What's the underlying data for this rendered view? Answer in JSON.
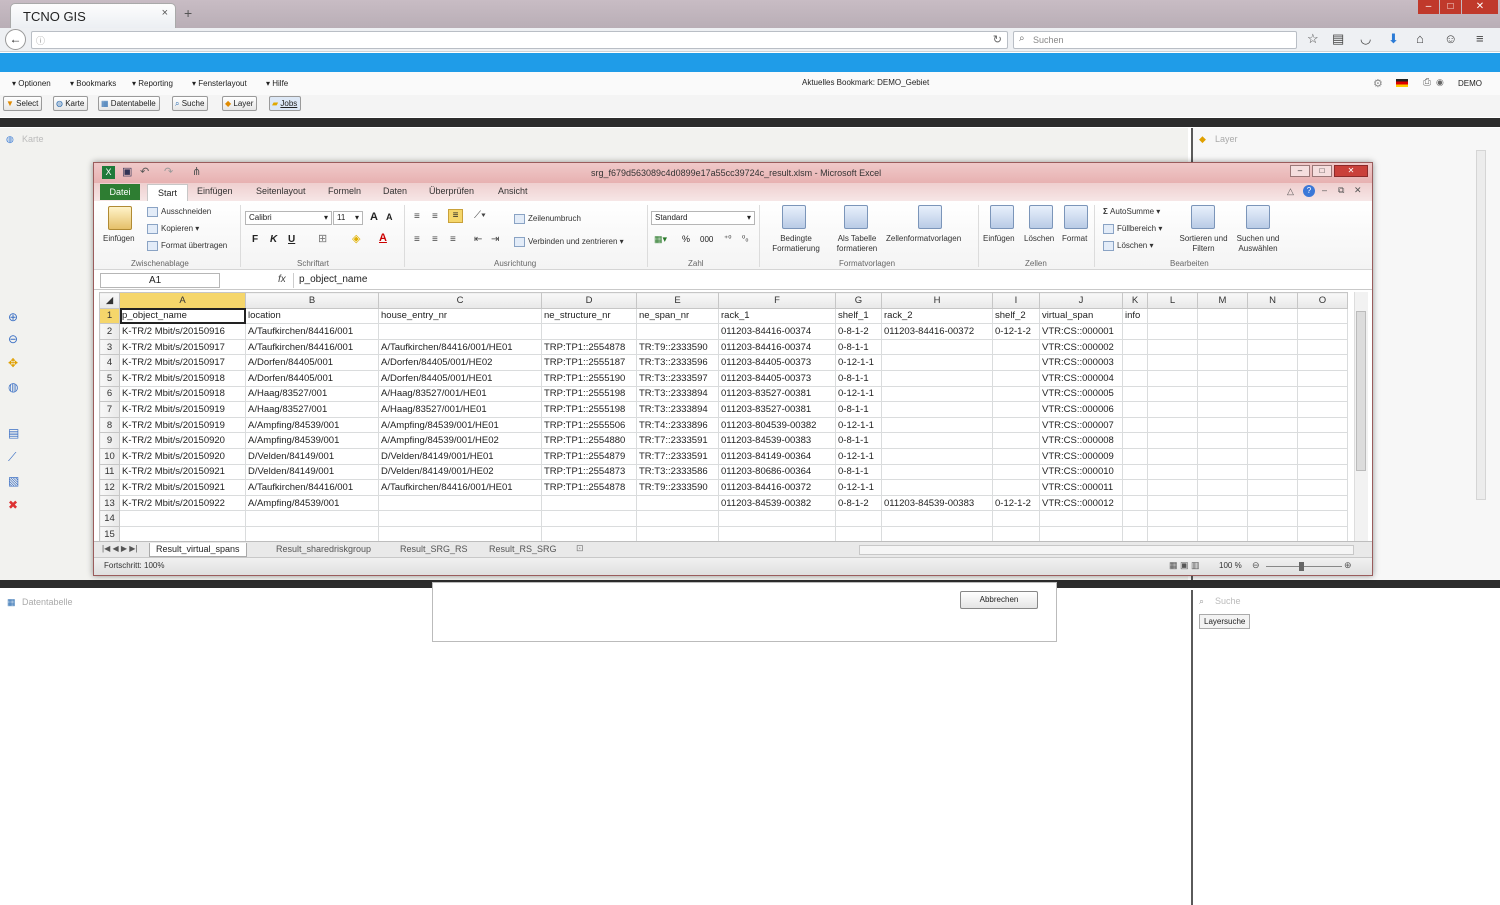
{
  "browser": {
    "tab_title": "TCNO GIS",
    "tab_close": "×",
    "new_tab": "+",
    "search_placeholder": "Suchen"
  },
  "app": {
    "menu": [
      "Optionen",
      "Bookmarks",
      "Reporting",
      "Fensterlayout",
      "Hilfe"
    ],
    "bookmark": "Aktuelles Bookmark: DEMO_Gebiet",
    "user": "DEMO",
    "toolbar": [
      "Select",
      "Karte",
      "Datentabelle",
      "Suche",
      "Layer",
      "Jobs"
    ],
    "panels": {
      "map": "Karte",
      "layer": "Layer",
      "datatable": "Datentabelle",
      "search": "Suche",
      "layer_search": "Layersuche"
    },
    "cancel_button": "Abbrechen"
  },
  "excel": {
    "title": "srg_f679d563089c4d0899e17a55cc39724c_result.xlsm - Microsoft Excel",
    "ribbon_tabs": [
      "Datei",
      "Start",
      "Einfügen",
      "Seitenlayout",
      "Formeln",
      "Daten",
      "Überprüfen",
      "Ansicht"
    ],
    "clipboard": {
      "paste": "Einfügen",
      "cut": "Ausschneiden",
      "copy": "Kopieren",
      "format_painter": "Format übertragen",
      "group": "Zwischenablage"
    },
    "font": {
      "name": "Calibri",
      "size": "11",
      "bold": "F",
      "italic": "K",
      "underline": "U",
      "group": "Schriftart"
    },
    "alignment": {
      "wrap": "Zeilenumbruch",
      "merge": "Verbinden und zentrieren",
      "group": "Ausrichtung"
    },
    "number": {
      "format": "Standard",
      "group": "Zahl"
    },
    "styles": {
      "conditional": "Bedingte Formatierung",
      "as_table": "Als Tabelle formatieren",
      "cell_styles": "Zellenformatvorlagen",
      "group": "Formatvorlagen"
    },
    "cells": {
      "insert": "Einfügen",
      "delete": "Löschen",
      "format": "Format",
      "group": "Zellen"
    },
    "editing": {
      "autosum": "AutoSumme",
      "fill": "Füllbereich",
      "clear": "Löschen",
      "sort": "Sortieren und Filtern",
      "find": "Suchen und Auswählen",
      "group": "Bearbeiten"
    },
    "name_box": "A1",
    "formula": "p_object_name",
    "columns": [
      "A",
      "B",
      "C",
      "D",
      "E",
      "F",
      "G",
      "H",
      "I",
      "J",
      "K",
      "L",
      "M",
      "N",
      "O"
    ],
    "rows": [
      [
        "p_object_name",
        "location",
        "house_entry_nr",
        "ne_structure_nr",
        "ne_span_nr",
        "rack_1",
        "shelf_1",
        "rack_2",
        "shelf_2",
        "virtual_span",
        "info",
        "",
        "",
        "",
        ""
      ],
      [
        "K-TR/2 Mbit/s/20150916",
        "A/Taufkirchen/84416/001",
        "",
        "",
        "",
        "011203-84416-00374",
        "0-8-1-2",
        "011203-84416-00372",
        "0-12-1-2",
        "VTR:CS::000001",
        "",
        "",
        "",
        "",
        ""
      ],
      [
        "K-TR/2 Mbit/s/20150917",
        "A/Taufkirchen/84416/001",
        "A/Taufkirchen/84416/001/HE01",
        "TRP:TP1::2554878",
        "TR:T9::2333590",
        "011203-84416-00374",
        "0-8-1-1",
        "",
        "",
        "VTR:CS::000002",
        "",
        "",
        "",
        "",
        ""
      ],
      [
        "K-TR/2 Mbit/s/20150917",
        "A/Dorfen/84405/001",
        "A/Dorfen/84405/001/HE02",
        "TRP:TP1::2555187",
        "TR:T3::2333596",
        "011203-84405-00373",
        "0-12-1-1",
        "",
        "",
        "VTR:CS::000003",
        "",
        "",
        "",
        "",
        ""
      ],
      [
        "K-TR/2 Mbit/s/20150918",
        "A/Dorfen/84405/001",
        "A/Dorfen/84405/001/HE01",
        "TRP:TP1::2555190",
        "TR:T3::2333597",
        "011203-84405-00373",
        "0-8-1-1",
        "",
        "",
        "VTR:CS::000004",
        "",
        "",
        "",
        "",
        ""
      ],
      [
        "K-TR/2 Mbit/s/20150918",
        "A/Haag/83527/001",
        "A/Haag/83527/001/HE01",
        "TRP:TP1::2555198",
        "TR:T3::2333894",
        "011203-83527-00381",
        "0-12-1-1",
        "",
        "",
        "VTR:CS::000005",
        "",
        "",
        "",
        "",
        ""
      ],
      [
        "K-TR/2 Mbit/s/20150919",
        "A/Haag/83527/001",
        "A/Haag/83527/001/HE01",
        "TRP:TP1::2555198",
        "TR:T3::2333894",
        "011203-83527-00381",
        "0-8-1-1",
        "",
        "",
        "VTR:CS::000006",
        "",
        "",
        "",
        "",
        ""
      ],
      [
        "K-TR/2 Mbit/s/20150919",
        "A/Ampfing/84539/001",
        "A/Ampfing/84539/001/HE01",
        "TRP:TP1::2555506",
        "TR:T4::2333896",
        "011203-804539-00382",
        "0-12-1-1",
        "",
        "",
        "VTR:CS::000007",
        "",
        "",
        "",
        "",
        ""
      ],
      [
        "K-TR/2 Mbit/s/20150920",
        "A/Ampfing/84539/001",
        "A/Ampfing/84539/001/HE02",
        "TRP:TP1::2554880",
        "TR:T7::2333591",
        "011203-84539-00383",
        "0-8-1-1",
        "",
        "",
        "VTR:CS::000008",
        "",
        "",
        "",
        "",
        ""
      ],
      [
        "K-TR/2 Mbit/s/20150920",
        "D/Velden/84149/001",
        "D/Velden/84149/001/HE01",
        "TRP:TP1::2554879",
        "TR:T7::2333591",
        "011203-84149-00364",
        "0-12-1-1",
        "",
        "",
        "VTR:CS::000009",
        "",
        "",
        "",
        "",
        ""
      ],
      [
        "K-TR/2 Mbit/s/20150921",
        "D/Velden/84149/001",
        "D/Velden/84149/001/HE02",
        "TRP:TP1::2554873",
        "TR:T3::2333586",
        "011203-80686-00364",
        "0-8-1-1",
        "",
        "",
        "VTR:CS::000010",
        "",
        "",
        "",
        "",
        ""
      ],
      [
        "K-TR/2 Mbit/s/20150921",
        "A/Taufkirchen/84416/001",
        "A/Taufkirchen/84416/001/HE01",
        "TRP:TP1::2554878",
        "TR:T9::2333590",
        "011203-84416-00372",
        "0-12-1-1",
        "",
        "",
        "VTR:CS::000011",
        "",
        "",
        "",
        "",
        ""
      ],
      [
        "K-TR/2 Mbit/s/20150922",
        "A/Ampfing/84539/001",
        "",
        "",
        "",
        "011203-84539-00382",
        "0-8-1-2",
        "011203-84539-00383",
        "0-12-1-2",
        "VTR:CS::000012",
        "",
        "",
        "",
        "",
        ""
      ],
      [
        "",
        "",
        "",
        "",
        "",
        "",
        "",
        "",
        "",
        "",
        "",
        "",
        "",
        "",
        ""
      ],
      [
        "",
        "",
        "",
        "",
        "",
        "",
        "",
        "",
        "",
        "",
        "",
        "",
        "",
        "",
        ""
      ]
    ],
    "sheets": [
      "Result_virtual_spans",
      "Result_sharedriskgroup",
      "Result_SRG_RS",
      "Result_RS_SRG"
    ],
    "status": "Fortschritt: 100%",
    "zoom": "100 %"
  },
  "colors": {
    "accent_blue": "#1f9ce8",
    "excel_green": "#2e7d32",
    "selection": "#f5d66b"
  }
}
